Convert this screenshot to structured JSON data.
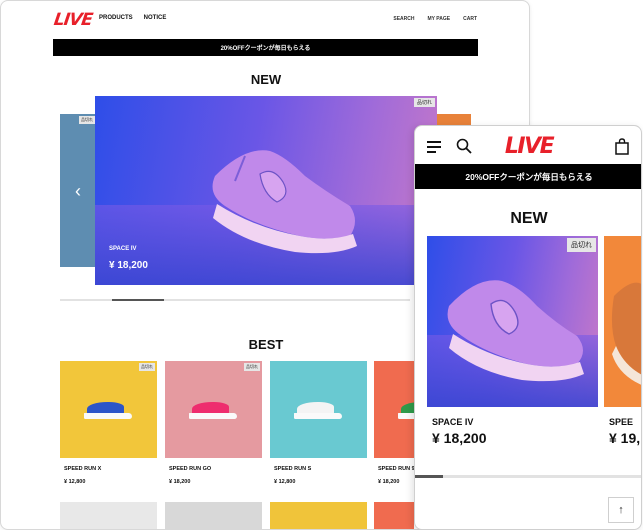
{
  "brand": {
    "logo_text": "LIVE",
    "accent": "#e8202a"
  },
  "desktop": {
    "nav": [
      "PRODUCTS",
      "NOTICE"
    ],
    "util": [
      "SEARCH",
      "MY PAGE",
      "CART"
    ],
    "banner": "20%OFFクーポンが毎日もらえる",
    "new_heading": "NEW",
    "new_slides": {
      "left_tag": "品切れ",
      "main": {
        "tag": "品切れ",
        "name": "SPACE IV",
        "price": "¥ 18,200"
      }
    },
    "best_heading": "BEST",
    "best_items": [
      {
        "name": "SPEED RUN X",
        "price": "¥ 12,800",
        "tag": "品切れ",
        "bg": "#f2c63a",
        "shoe": "#2c55c8"
      },
      {
        "name": "SPEED RUN GO",
        "price": "¥ 18,200",
        "tag": "品切れ",
        "bg": "#e59aa0",
        "shoe": "#ee2d6e"
      },
      {
        "name": "SPEED RUN S",
        "price": "¥ 12,800",
        "tag": "",
        "bg": "#69c9d1",
        "shoe": "#f4f4f4"
      },
      {
        "name": "SPEED RUN 9",
        "price": "¥ 18,200",
        "tag": "",
        "bg": "#f06b4f",
        "shoe": "#2f9a4a"
      }
    ],
    "row2_colors": [
      "#e8e8e8",
      "#d8d8d8",
      "#f0c43a",
      "#f06b4f"
    ]
  },
  "mobile": {
    "banner": "20%OFFクーポンが毎日もらえる",
    "new_heading": "NEW",
    "card": {
      "tag": "品切れ",
      "name": "SPACE IV",
      "price": "¥ 18,200"
    },
    "next_card": {
      "name": "SPEE",
      "price": "¥ 19,"
    },
    "top_arrow": "↑"
  }
}
